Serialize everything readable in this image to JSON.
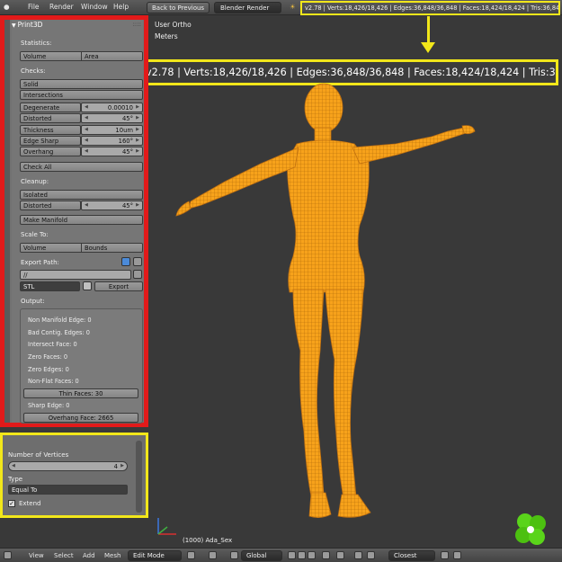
{
  "topbar": {
    "menus": [
      "File",
      "Render",
      "Window",
      "Help"
    ],
    "back_button": "Back to Previous",
    "engine": "Blender Render",
    "stats": "v2.78 | Verts:18,426/18,426 | Edges:36,848/36,848 | Faces:18,424/18,424 | Tris:36,848"
  },
  "shelf": {
    "panel_title": "Print3D",
    "statistics_label": "Statistics:",
    "stat_buttons": [
      "Volume",
      "Area"
    ],
    "checks_label": "Checks:",
    "solid_button": "Solid",
    "intersections_button": "Intersections",
    "checks": [
      {
        "label": "Degenerate",
        "value": "0.00010"
      },
      {
        "label": "Distorted",
        "value": "45°"
      },
      {
        "label": "Thickness",
        "value": "10um"
      },
      {
        "label": "Edge Sharp",
        "value": "160°"
      },
      {
        "label": "Overhang",
        "value": "45°"
      }
    ],
    "check_all_button": "Check All",
    "cleanup_label": "Cleanup:",
    "isolated_button": "Isolated",
    "distorted_cleanup": {
      "label": "Distorted",
      "value": "45°"
    },
    "make_manifold_button": "Make Manifold",
    "scale_label": "Scale To:",
    "scale_buttons": [
      "Volume",
      "Bounds"
    ],
    "export_path_label": "Export Path:",
    "export_path_value": "//",
    "format_value": "STL",
    "export_button": "Export",
    "output_label": "Output:",
    "output_lines": [
      "Non Manifold Edge: 0",
      "Bad Contig. Edges: 0",
      "Intersect Face: 0",
      "Zero Faces: 0",
      "Zero Edges: 0",
      "Non-Flat Faces: 0"
    ],
    "thin_faces_button": "Thin Faces: 30",
    "sharp_edge_line": "Sharp Edge: 0",
    "overhang_button": "Overhang Face: 2665"
  },
  "operator": {
    "vertices_label": "Number of Vertices",
    "vertices_value": "4",
    "type_label": "Type",
    "type_value": "Equal To",
    "extend_label": "Extend",
    "extend_checked": true
  },
  "viewport": {
    "view_name": "User Ortho",
    "units": "Meters",
    "object_info": "(1000) Ada_Sex",
    "mesh_color": "#f7a21b"
  },
  "bottombar": {
    "menus": [
      "View",
      "Select",
      "Add",
      "Mesh"
    ],
    "mode": "Edit Mode",
    "orientation": "Global",
    "snap": "Closest"
  }
}
